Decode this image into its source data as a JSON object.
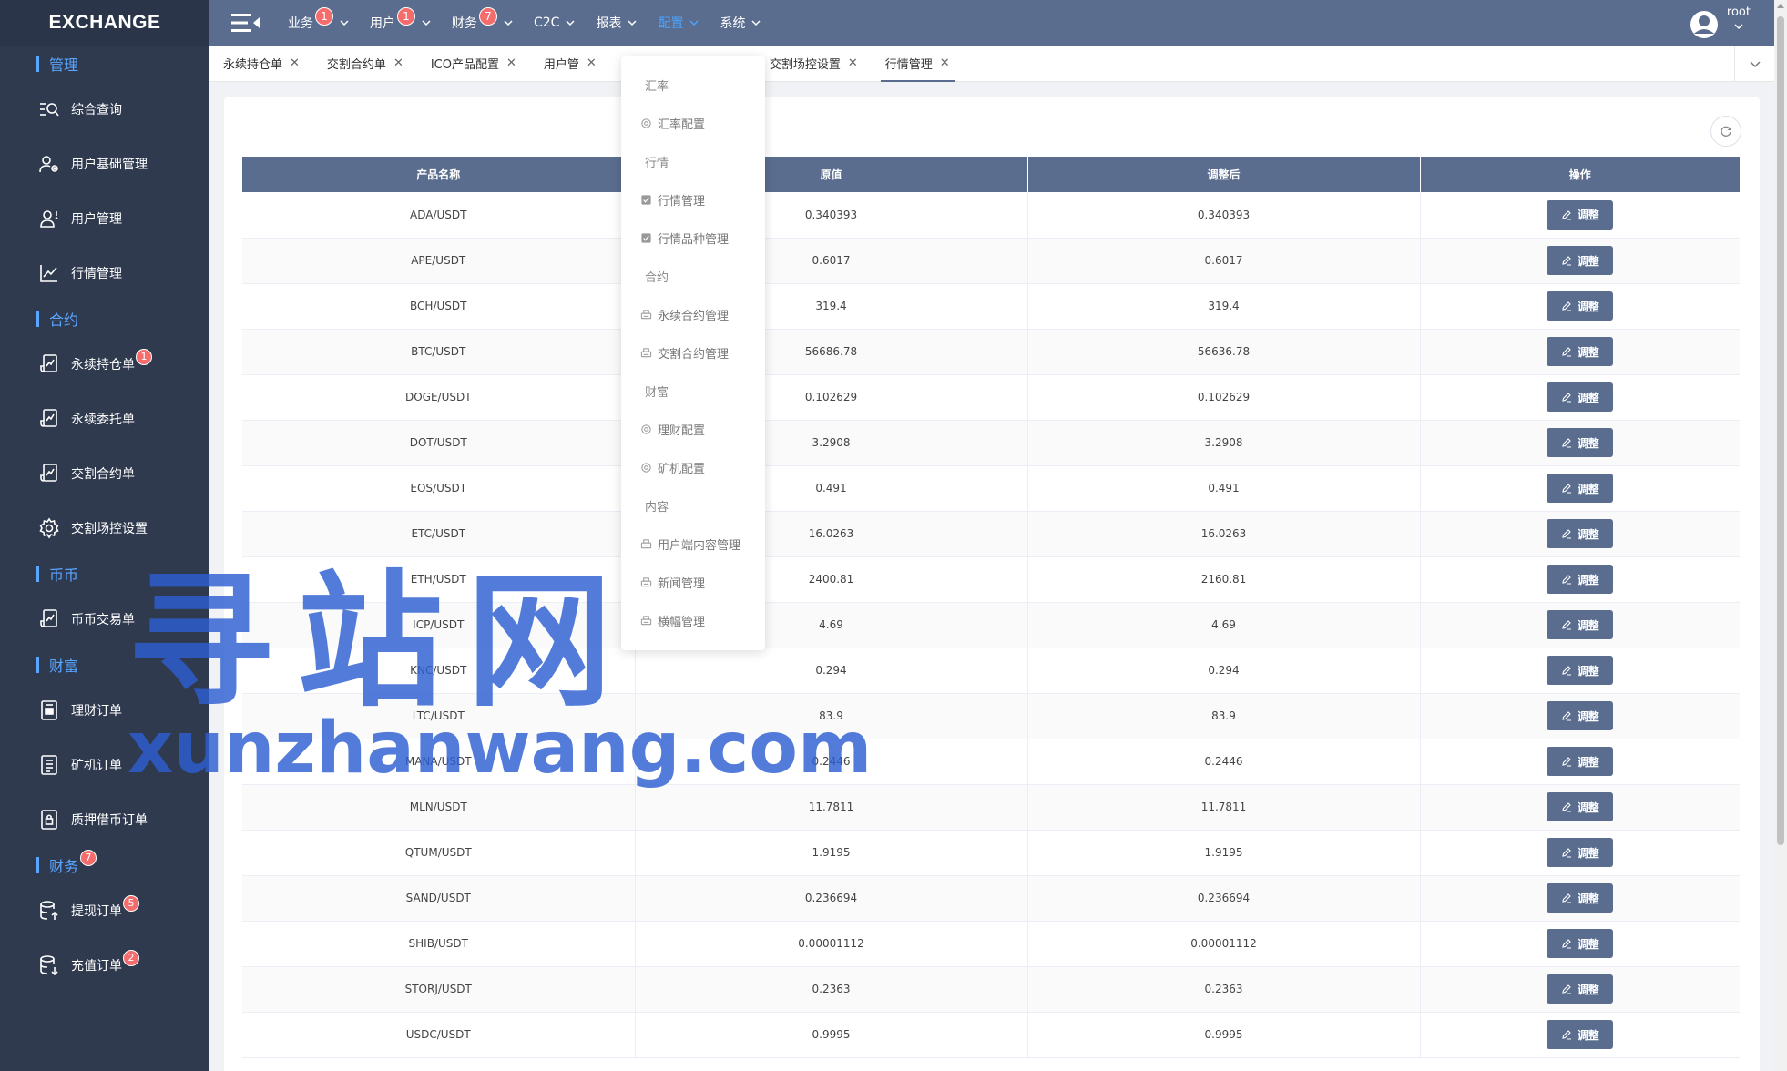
{
  "app": {
    "logo": "EXCHANGE"
  },
  "sidebar": {
    "sections": [
      {
        "title": "管理",
        "badge": "",
        "items": [
          {
            "label": "综合查询",
            "icon": "search-list-icon",
            "badge": ""
          },
          {
            "label": "用户基础管理",
            "icon": "user-settings-icon",
            "badge": ""
          },
          {
            "label": "用户管理",
            "icon": "user-icon",
            "badge": ""
          },
          {
            "label": "行情管理",
            "icon": "line-chart-icon",
            "badge": ""
          }
        ]
      },
      {
        "title": "合约",
        "badge": "",
        "items": [
          {
            "label": "永续持仓单",
            "icon": "document-chart-icon",
            "badge": "1"
          },
          {
            "label": "永续委托单",
            "icon": "document-chart-icon",
            "badge": ""
          },
          {
            "label": "交割合约单",
            "icon": "document-chart-icon",
            "badge": ""
          },
          {
            "label": "交割场控设置",
            "icon": "gear-icon",
            "badge": ""
          }
        ]
      },
      {
        "title": "币币",
        "badge": "",
        "items": [
          {
            "label": "币币交易单",
            "icon": "document-chart-icon",
            "badge": ""
          }
        ]
      },
      {
        "title": "财富",
        "badge": "",
        "items": [
          {
            "label": "理财订单",
            "icon": "document-icon",
            "badge": ""
          },
          {
            "label": "矿机订单",
            "icon": "document-list-icon",
            "badge": ""
          },
          {
            "label": "质押借币订单",
            "icon": "document-lock-icon",
            "badge": ""
          }
        ]
      },
      {
        "title": "财务",
        "badge": "7",
        "items": [
          {
            "label": "提现订单",
            "icon": "database-up-icon",
            "badge": "5"
          },
          {
            "label": "充值订单",
            "icon": "database-down-icon",
            "badge": "2"
          }
        ]
      }
    ]
  },
  "topnav": {
    "items": [
      {
        "label": "业务",
        "badge": "1",
        "active": false
      },
      {
        "label": "用户",
        "badge": "1",
        "active": false
      },
      {
        "label": "财务",
        "badge": "7",
        "active": false
      },
      {
        "label": "C2C",
        "badge": "",
        "active": false
      },
      {
        "label": "报表",
        "badge": "",
        "active": false
      },
      {
        "label": "配置",
        "badge": "",
        "active": true
      },
      {
        "label": "系统",
        "badge": "",
        "active": false
      }
    ],
    "user": "root"
  },
  "tabs": [
    {
      "label": "永续持仓单",
      "active": false
    },
    {
      "label": "交割合约单",
      "active": false
    },
    {
      "label": "ICO产品配置",
      "active": false
    },
    {
      "label": "用户管",
      "active": false
    },
    {
      "label": "交割场控设置",
      "active": false
    },
    {
      "label": "行情管理",
      "active": true
    }
  ],
  "dropdown": [
    {
      "type": "group",
      "label": "汇率"
    },
    {
      "type": "item",
      "label": "汇率配置",
      "icon": "gear-icon"
    },
    {
      "type": "group",
      "label": "行情"
    },
    {
      "type": "item",
      "label": "行情管理",
      "icon": "checkbox-icon"
    },
    {
      "type": "item",
      "label": "行情品种管理",
      "icon": "checkbox-icon"
    },
    {
      "type": "group",
      "label": "合约"
    },
    {
      "type": "item",
      "label": "永续合约管理",
      "icon": "printer-icon"
    },
    {
      "type": "item",
      "label": "交割合约管理",
      "icon": "printer-icon"
    },
    {
      "type": "group",
      "label": "财富"
    },
    {
      "type": "item",
      "label": "理财配置",
      "icon": "gear-icon"
    },
    {
      "type": "item",
      "label": "矿机配置",
      "icon": "gear-icon"
    },
    {
      "type": "group",
      "label": "内容"
    },
    {
      "type": "item",
      "label": "用户端内容管理",
      "icon": "printer-icon"
    },
    {
      "type": "item",
      "label": "新闻管理",
      "icon": "printer-icon"
    },
    {
      "type": "item",
      "label": "横幅管理",
      "icon": "printer-icon"
    }
  ],
  "table": {
    "headers": [
      "产品名称",
      "原值",
      "调整后",
      "操作"
    ],
    "action_label": "调整",
    "rows": [
      [
        "ADA/USDT",
        "0.340393",
        "0.340393"
      ],
      [
        "APE/USDT",
        "0.6017",
        "0.6017"
      ],
      [
        "BCH/USDT",
        "319.4",
        "319.4"
      ],
      [
        "BTC/USDT",
        "56686.78",
        "56636.78"
      ],
      [
        "DOGE/USDT",
        "0.102629",
        "0.102629"
      ],
      [
        "DOT/USDT",
        "3.2908",
        "3.2908"
      ],
      [
        "EOS/USDT",
        "0.491",
        "0.491"
      ],
      [
        "ETC/USDT",
        "16.0263",
        "16.0263"
      ],
      [
        "ETH/USDT",
        "2400.81",
        "2160.81"
      ],
      [
        "ICP/USDT",
        "4.69",
        "4.69"
      ],
      [
        "KNC/USDT",
        "0.294",
        "0.294"
      ],
      [
        "LTC/USDT",
        "83.9",
        "83.9"
      ],
      [
        "MANA/USDT",
        "0.2446",
        "0.2446"
      ],
      [
        "MLN/USDT",
        "11.7811",
        "11.7811"
      ],
      [
        "QTUM/USDT",
        "1.9195",
        "1.9195"
      ],
      [
        "SAND/USDT",
        "0.236694",
        "0.236694"
      ],
      [
        "SHIB/USDT",
        "0.00001112",
        "0.00001112"
      ],
      [
        "STORJ/USDT",
        "0.2363",
        "0.2363"
      ],
      [
        "USDC/USDT",
        "0.9995",
        "0.9995"
      ]
    ]
  },
  "watermark": {
    "line1": "寻站网",
    "line2": "xunzhanwang.com"
  }
}
